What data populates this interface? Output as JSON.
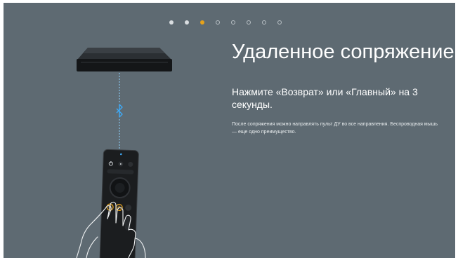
{
  "pager": {
    "total": 8,
    "active_index": 2,
    "dots": [
      "filled",
      "filled",
      "active",
      "empty",
      "empty",
      "empty",
      "empty",
      "empty"
    ]
  },
  "content": {
    "title": "Удаленное сопряжение",
    "instruction": "Нажмите «Возврат» или «Главный» на 3 секунды.",
    "hint": "После сопряжения можно направлять пульт ДУ во все направления. Беспроводная мышь — еще одно преимущество."
  },
  "icons": {
    "bluetooth": "bluetooth-icon",
    "power": "power-icon",
    "back": "back-icon",
    "home": "home-icon"
  },
  "colors": {
    "background": "#5e6a72",
    "accent": "#e6a21a",
    "bluetooth": "#3fa9f5",
    "connector": "#8fd3ff"
  }
}
